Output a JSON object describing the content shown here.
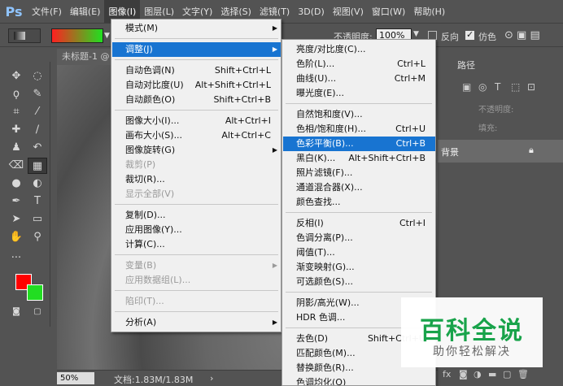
{
  "app": {
    "logo": "Ps"
  },
  "menubar": [
    "文件(F)",
    "编辑(E)",
    "图像(I)",
    "图层(L)",
    "文字(Y)",
    "选择(S)",
    "滤镜(T)",
    "3D(D)",
    "视图(V)",
    "窗口(W)",
    "帮助(H)"
  ],
  "options": {
    "opacity_label": "不透明度:",
    "opacity_value": "100%",
    "reverse_label": "反向",
    "dither_label": "仿色",
    "dither_checked": true,
    "reverse_checked": false,
    "foreground_color": "#ff0000",
    "background_color": "#22dd22"
  },
  "document": {
    "tab_title": "未标题-1 @",
    "zoom": "50%",
    "doc_info": "文档:1.83M/1.83M",
    "status_arrow": "›"
  },
  "panels": {
    "path_tab": "路径",
    "opacity_label": "不透明度:",
    "fill_label": "填充:",
    "layer_name": "背景"
  },
  "image_menu": {
    "items": [
      {
        "label": "模式(M)",
        "shortcut": "",
        "submenu": true,
        "disabled": false
      },
      {
        "label": "调整(J)",
        "shortcut": "",
        "submenu": true,
        "disabled": false,
        "highlight": true
      },
      {
        "label": "自动色调(N)",
        "shortcut": "Shift+Ctrl+L"
      },
      {
        "label": "自动对比度(U)",
        "shortcut": "Alt+Shift+Ctrl+L"
      },
      {
        "label": "自动颜色(O)",
        "shortcut": "Shift+Ctrl+B"
      },
      {
        "label": "图像大小(I)...",
        "shortcut": "Alt+Ctrl+I"
      },
      {
        "label": "画布大小(S)...",
        "shortcut": "Alt+Ctrl+C"
      },
      {
        "label": "图像旋转(G)",
        "shortcut": "",
        "submenu": true
      },
      {
        "label": "裁剪(P)",
        "shortcut": "",
        "disabled": true
      },
      {
        "label": "裁切(R)...",
        "shortcut": ""
      },
      {
        "label": "显示全部(V)",
        "shortcut": "",
        "disabled": true
      },
      {
        "label": "复制(D)...",
        "shortcut": ""
      },
      {
        "label": "应用图像(Y)...",
        "shortcut": ""
      },
      {
        "label": "计算(C)...",
        "shortcut": ""
      },
      {
        "label": "变量(B)",
        "shortcut": "",
        "submenu": true,
        "disabled": true
      },
      {
        "label": "应用数据组(L)...",
        "shortcut": "",
        "disabled": true
      },
      {
        "label": "陷印(T)...",
        "shortcut": "",
        "disabled": true
      },
      {
        "label": "分析(A)",
        "shortcut": "",
        "submenu": true
      }
    ]
  },
  "adjust_menu": {
    "items": [
      {
        "label": "亮度/对比度(C)...",
        "shortcut": ""
      },
      {
        "label": "色阶(L)...",
        "shortcut": "Ctrl+L"
      },
      {
        "label": "曲线(U)...",
        "shortcut": "Ctrl+M"
      },
      {
        "label": "曝光度(E)...",
        "shortcut": ""
      },
      {
        "label": "自然饱和度(V)...",
        "shortcut": ""
      },
      {
        "label": "色相/饱和度(H)...",
        "shortcut": "Ctrl+U"
      },
      {
        "label": "色彩平衡(B)...",
        "shortcut": "Ctrl+B",
        "highlight": true
      },
      {
        "label": "黑白(K)...",
        "shortcut": "Alt+Shift+Ctrl+B"
      },
      {
        "label": "照片滤镜(F)...",
        "shortcut": ""
      },
      {
        "label": "通道混合器(X)...",
        "shortcut": ""
      },
      {
        "label": "颜色查找...",
        "shortcut": ""
      },
      {
        "label": "反相(I)",
        "shortcut": "Ctrl+I"
      },
      {
        "label": "色调分离(P)...",
        "shortcut": ""
      },
      {
        "label": "阈值(T)...",
        "shortcut": ""
      },
      {
        "label": "渐变映射(G)...",
        "shortcut": ""
      },
      {
        "label": "可选颜色(S)...",
        "shortcut": ""
      },
      {
        "label": "阴影/高光(W)...",
        "shortcut": ""
      },
      {
        "label": "HDR 色调...",
        "shortcut": ""
      },
      {
        "label": "去色(D)",
        "shortcut": "Shift+Ctrl+U"
      },
      {
        "label": "匹配颜色(M)...",
        "shortcut": ""
      },
      {
        "label": "替换颜色(R)...",
        "shortcut": ""
      },
      {
        "label": "色调均化(Q)",
        "shortcut": ""
      }
    ]
  },
  "watermark": {
    "title": "百科全说",
    "subtitle": "助你轻松解决"
  }
}
